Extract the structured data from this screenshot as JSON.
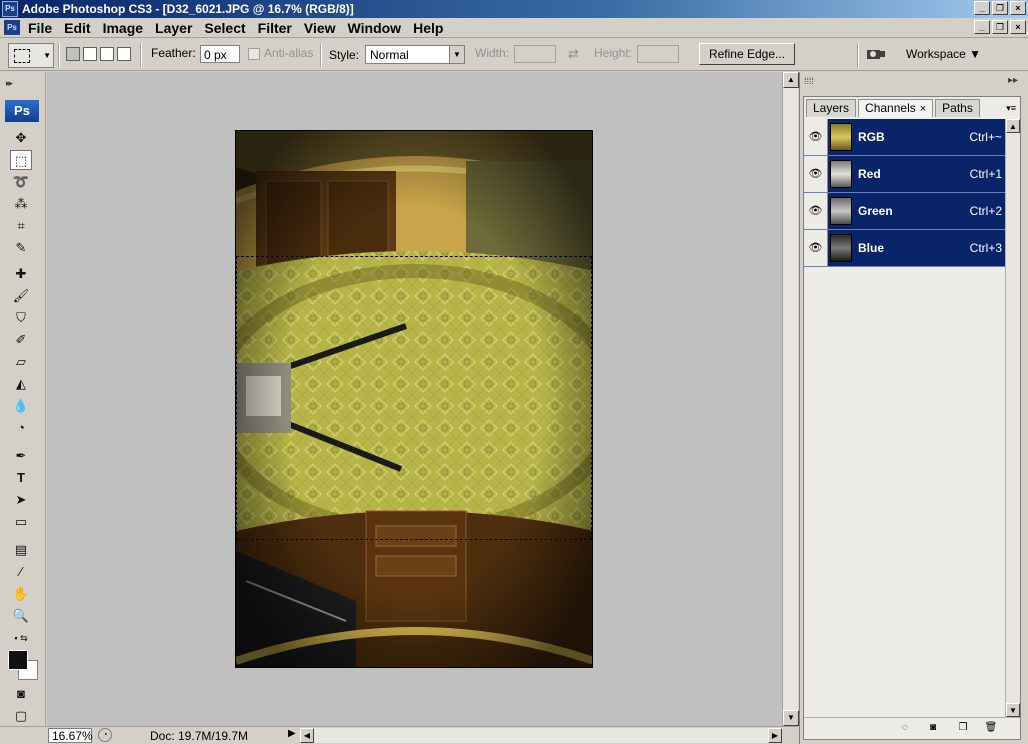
{
  "window": {
    "title": "Adobe Photoshop CS3 - [D32_6021.JPG @ 16.7% (RGB/8)]",
    "app_icon": "Ps"
  },
  "menu": [
    "File",
    "Edit",
    "Image",
    "Layer",
    "Select",
    "Filter",
    "View",
    "Window",
    "Help"
  ],
  "options": {
    "feather_label": "Feather:",
    "feather_value": "0 px",
    "antialias_label": "Anti-alias",
    "style_label": "Style:",
    "style_value": "Normal",
    "width_label": "Width:",
    "height_label": "Height:",
    "refine_edge_label": "Refine Edge...",
    "workspace_label": "Workspace"
  },
  "toolbox": {
    "logo": "Ps",
    "tools": [
      "move-tool",
      "rectangular-marquee-tool",
      "lasso-tool",
      "magic-wand-tool",
      "crop-tool",
      "slice-tool",
      "healing-brush-tool",
      "brush-tool",
      "clone-stamp-tool",
      "history-brush-tool",
      "eraser-tool",
      "paint-bucket-tool",
      "blur-tool",
      "dodge-tool",
      "pen-tool",
      "type-tool",
      "path-selection-tool",
      "rectangle-tool",
      "notes-tool",
      "eyedropper-tool",
      "hand-tool",
      "zoom-tool"
    ],
    "foreground_color": "#111111",
    "background_color": "#ffffff"
  },
  "status": {
    "zoom": "16.67%",
    "doc_size": "Doc: 19.7M/19.7M"
  },
  "channels_panel": {
    "tabs": [
      {
        "label": "Layers",
        "active": false
      },
      {
        "label": "Channels",
        "active": true
      },
      {
        "label": "Paths",
        "active": false
      }
    ],
    "channels": [
      {
        "name": "RGB",
        "shortcut": "Ctrl+~",
        "thumb": "#c9b84a"
      },
      {
        "name": "Red",
        "shortcut": "Ctrl+1",
        "thumb": "#cfcfcf"
      },
      {
        "name": "Green",
        "shortcut": "Ctrl+2",
        "thumb": "#b5b5b5"
      },
      {
        "name": "Blue",
        "shortcut": "Ctrl+3",
        "thumb": "#6a6a6a"
      }
    ]
  },
  "colors": {
    "selection_row": "#0a246a",
    "accent": "#3a6ea5"
  }
}
